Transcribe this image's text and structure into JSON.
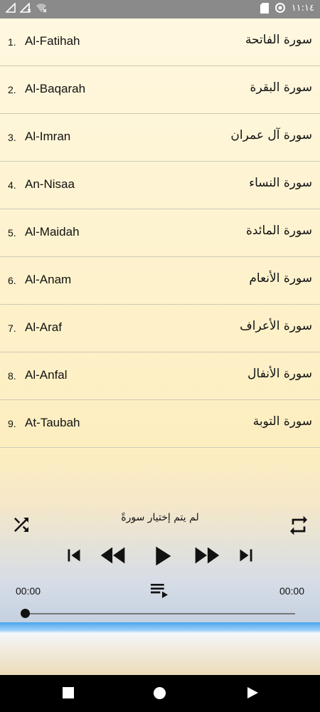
{
  "status_bar": {
    "time": "١١:١٤",
    "left_icons": [
      "signal-icon",
      "no-sim-icon",
      "wifi-off-icon"
    ],
    "right_icons": [
      "sd-card-icon",
      "data-saver-icon"
    ]
  },
  "surahs": [
    {
      "number": "1.",
      "name_en": "Al-Fatihah",
      "name_ar": "سورة الفاتحة"
    },
    {
      "number": "2.",
      "name_en": "Al-Baqarah",
      "name_ar": "سورة البقرة"
    },
    {
      "number": "3.",
      "name_en": "Al-Imran",
      "name_ar": "سورة آل عمران"
    },
    {
      "number": "4.",
      "name_en": "An-Nisaa",
      "name_ar": "سورة النساء"
    },
    {
      "number": "5.",
      "name_en": "Al-Maidah",
      "name_ar": "سورة المائدة"
    },
    {
      "number": "6.",
      "name_en": "Al-Anam",
      "name_ar": "سورة الأنعام"
    },
    {
      "number": "7.",
      "name_en": "Al-Araf",
      "name_ar": "سورة الأعراف"
    },
    {
      "number": "8.",
      "name_en": "Al-Anfal",
      "name_ar": "سورة الأنفال"
    },
    {
      "number": "9.",
      "name_en": "At-Taubah",
      "name_ar": "سورة التوبة"
    }
  ],
  "player": {
    "now_playing": "لم يتم إختيار سورةً",
    "elapsed": "00:00",
    "duration": "00:00",
    "progress": 0,
    "icons": [
      "shuffle-icon",
      "repeat-icon",
      "skip-previous-icon",
      "rewind-icon",
      "play-icon",
      "fast-forward-icon",
      "skip-next-icon",
      "playlist-icon"
    ]
  },
  "nav": {
    "icons": [
      "recents-icon",
      "home-icon",
      "back-icon"
    ]
  }
}
